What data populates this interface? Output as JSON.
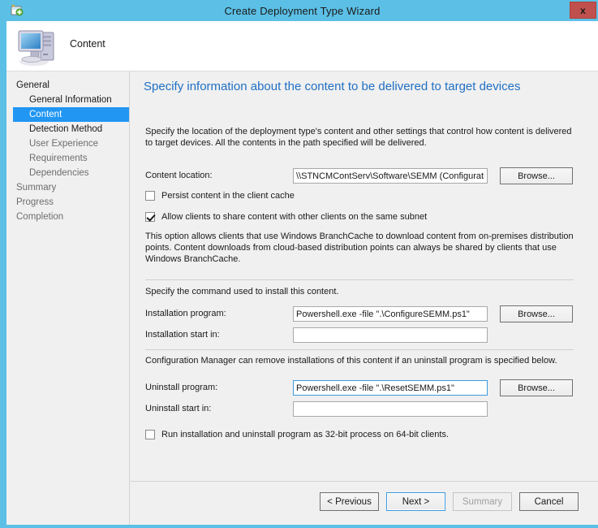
{
  "window": {
    "title": "Create Deployment Type Wizard",
    "close_label": "x",
    "title_icon": "deployment-type-icon"
  },
  "header": {
    "label": "Content",
    "icon": "computer-monitor-icon"
  },
  "sidebar": {
    "items": [
      {
        "label": "General",
        "level": "top",
        "state": "normal"
      },
      {
        "label": "General Information",
        "level": "sub",
        "state": "normal"
      },
      {
        "label": "Content",
        "level": "sub",
        "state": "selected"
      },
      {
        "label": "Detection Method",
        "level": "sub",
        "state": "normal"
      },
      {
        "label": "User Experience",
        "level": "sub",
        "state": "dim"
      },
      {
        "label": "Requirements",
        "level": "sub",
        "state": "dim"
      },
      {
        "label": "Dependencies",
        "level": "sub",
        "state": "dim"
      },
      {
        "label": "Summary",
        "level": "top",
        "state": "dim"
      },
      {
        "label": "Progress",
        "level": "top",
        "state": "dim"
      },
      {
        "label": "Completion",
        "level": "top",
        "state": "dim"
      }
    ]
  },
  "pane": {
    "title": "Specify information about the content to be delivered to target devices",
    "intro": "Specify the location of the deployment type's content and other settings that control how content is delivered to target devices. All the contents in the path specified will be delivered.",
    "content_location_label": "Content location:",
    "content_location_value": "\\\\STNCMContServ\\Software\\SEMM (Configuratio",
    "browse_label": "Browse...",
    "browse_accesskey": "B",
    "persist_label": "Persist content in the client cache",
    "persist_checked": false,
    "share_label": "Allow clients to share content with other clients on the same subnet",
    "share_checked": true,
    "branchcache_note": "This option allows clients that use Windows BranchCache to download content from on-premises distribution points. Content downloads from cloud-based distribution points can always be shared by clients that use Windows BranchCache.",
    "install_section_note": "Specify the command used to install this content.",
    "installation_program_label": "Installation program:",
    "installation_program_value": "Powershell.exe -file \".\\ConfigureSEMM.ps1\"",
    "installation_start_in_label": "Installation start in:",
    "installation_start_in_value": "",
    "uninstall_section_note": "Configuration Manager can remove installations of this content if an uninstall program is specified below.",
    "uninstall_program_label": "Uninstall program:",
    "uninstall_program_value": "Powershell.exe -file \".\\ResetSEMM.ps1\"",
    "uninstall_start_in_label": "Uninstall start in:",
    "uninstall_start_in_value": "",
    "run_32bit_label": "Run installation and uninstall program as 32-bit process on 64-bit clients.",
    "run_32bit_checked": false
  },
  "footer": {
    "previous_label": "< Previous",
    "next_label": "Next >",
    "summary_label": "Summary",
    "cancel_label": "Cancel"
  },
  "colors": {
    "titlebar": "#5cc0e6",
    "accent_selected": "#2196f3",
    "pane_title": "#1f6fc4",
    "close_button": "#c0504d"
  }
}
